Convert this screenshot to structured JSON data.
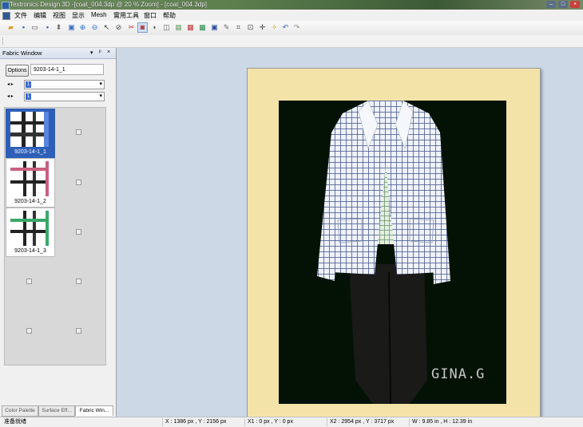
{
  "window": {
    "title": "Textronics Design 3D -[coat_004.3dp  @ 20 % Zoom] - [coat_004.3dp]"
  },
  "menu": [
    "文件",
    "编辑",
    "视图",
    "显示",
    "Mesh",
    "實用工具",
    "窗口",
    "帮助"
  ],
  "toolbar": {
    "icons": [
      "folder-open-icon",
      "save-icon",
      "print-icon",
      "save-all-icon",
      "import-icon",
      "export-icon",
      "zoom-in-icon",
      "zoom-out-icon",
      "pointer-icon",
      "rotate-icon",
      "cut-mesh-icon",
      "fabric-render-icon",
      "brush-icon",
      "eraser-icon",
      "fill-icon",
      "pattern-icon",
      "texture-icon",
      "display-icon",
      "crop-icon",
      "fit-icon",
      "move-icon",
      "light-icon",
      "undo-icon",
      "redo-icon"
    ]
  },
  "fabric_panel": {
    "title": "Fabric Window",
    "options_label": "Options",
    "fabric_name": "9203-14-1_1",
    "combo1_value": "1",
    "combo2_value": "1",
    "swatches": [
      {
        "label": "9203-14-1_1",
        "selected": true,
        "accent": "#4a78d8"
      },
      {
        "label": "9203-14-1_2",
        "selected": false,
        "accent": "#c96080"
      },
      {
        "label": "9203-14-1_3",
        "selected": false,
        "accent": "#3aa86a"
      }
    ],
    "tabs": [
      "Color Palette",
      "Surface Eff...",
      "Fabric Win..."
    ]
  },
  "canvas": {
    "watermark": "GINA.G"
  },
  "status": {
    "ready": "准备就绪",
    "cursor": "X : 1386 px , Y : 2156 px",
    "origin": "X1 : 0 px , Y : 0 px",
    "extent": "X2 : 2954 px , Y : 3717 px",
    "size": "W : 9.85 in , H : 12.39 in"
  }
}
